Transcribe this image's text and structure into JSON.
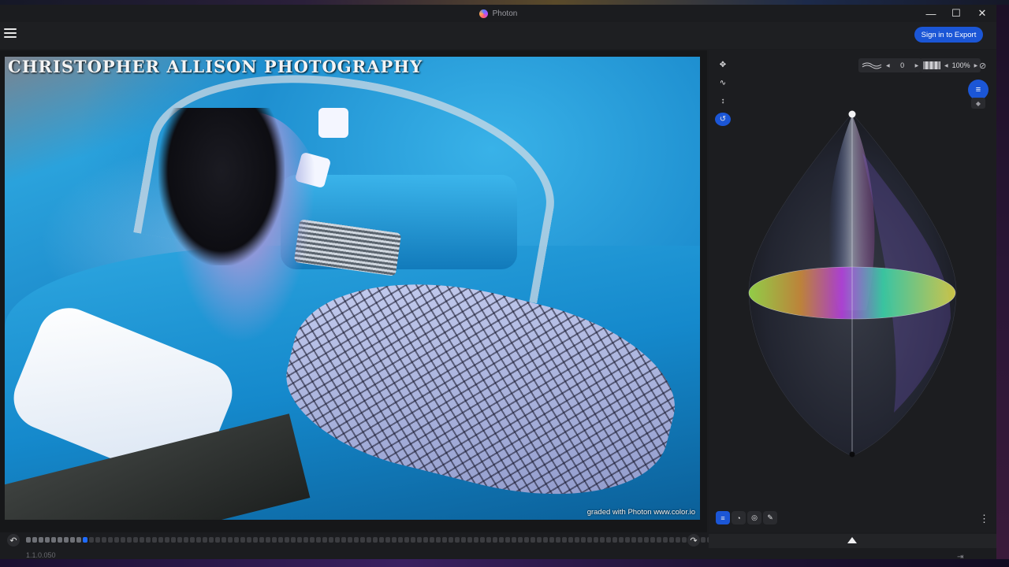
{
  "window": {
    "title": "Photon",
    "minimize_glyph": "—",
    "maximize_glyph": "☐",
    "close_glyph": "✕"
  },
  "toolbar": {
    "signin_label": "Sign in to Export"
  },
  "photo": {
    "watermark": "CHRISTOPHER ALLISON PHOTOGRAPHY",
    "credit": "graded with Photon  www.color.io"
  },
  "timeline": {
    "undo_glyph": "↶",
    "redo_glyph": "↷",
    "total_steps": 120,
    "filled_steps": 9,
    "current_step": 10
  },
  "version": "1.1.0.050",
  "side_panel": {
    "tools": [
      {
        "name": "move-icon",
        "glyph": "✥"
      },
      {
        "name": "curve-icon",
        "glyph": "∿"
      },
      {
        "name": "vertical-arrows-icon",
        "glyph": "↕"
      },
      {
        "name": "rotate-icon",
        "glyph": "↺"
      }
    ],
    "density_value": "0",
    "zoom_value": "100%",
    "eye_glyph": "⊘",
    "layer_glyph": "≡",
    "tag_glyph": "◆",
    "bottom_tools": [
      {
        "name": "layers-view-icon",
        "glyph": "≡"
      },
      {
        "name": "color-wheel-icon",
        "glyph": "◔"
      },
      {
        "name": "target-icon",
        "glyph": "◎"
      },
      {
        "name": "eyedropper-icon",
        "glyph": "✎"
      }
    ],
    "menu_glyph": "⋮",
    "pin_glyph": "⇥"
  },
  "colors": {
    "accent": "#1b56d6",
    "panel_bg": "#1c1d20",
    "timeline_current": "#1f6bff"
  }
}
